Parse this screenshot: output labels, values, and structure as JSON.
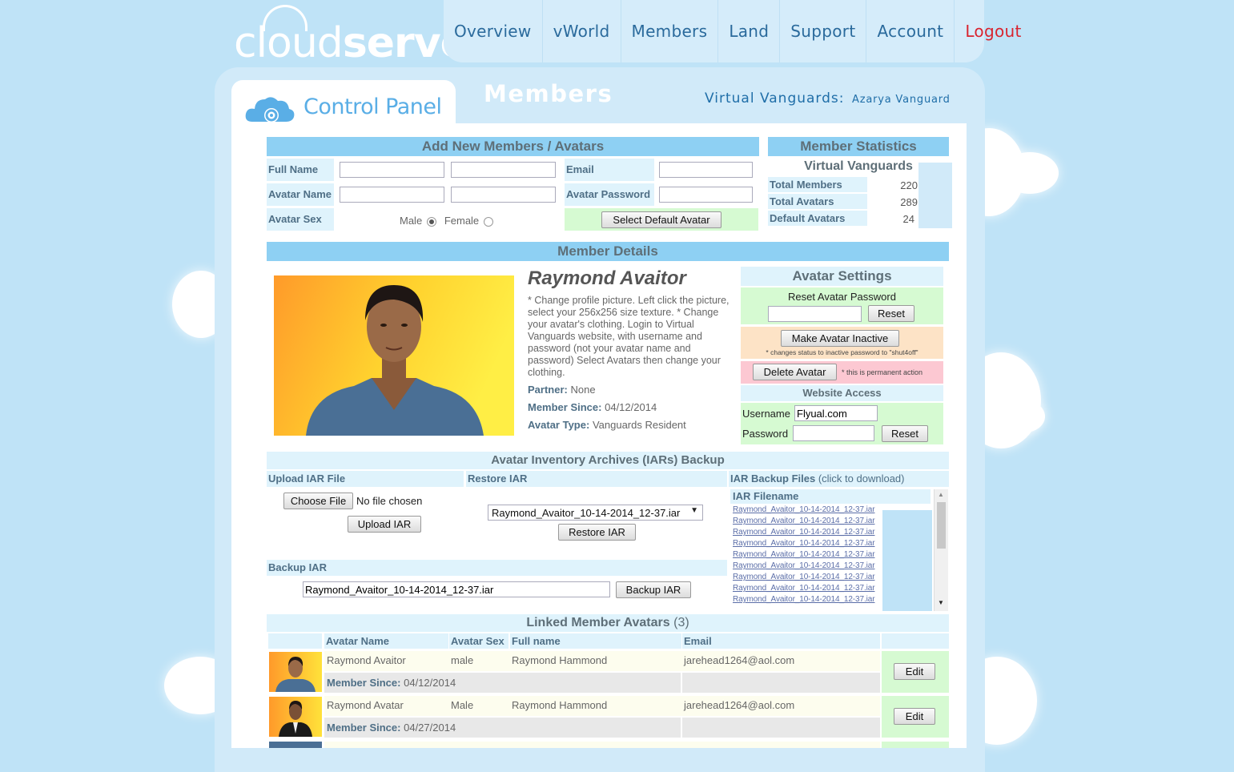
{
  "brand": {
    "logo_light": "cloud",
    "logo_bold": "serve"
  },
  "nav": [
    {
      "label": "Overview"
    },
    {
      "label": "vWorld"
    },
    {
      "label": "Members"
    },
    {
      "label": "Land"
    },
    {
      "label": "Support"
    },
    {
      "label": "Account"
    },
    {
      "label": "Logout"
    }
  ],
  "control_panel": {
    "label": "Control Panel"
  },
  "page": {
    "title": "Members",
    "group_label": "Virtual Vanguards:",
    "user_name": "Azarya Vanguard"
  },
  "add_members": {
    "title": "Add New Members / Avatars",
    "full_name_label": "Full Name",
    "avatar_name_label": "Avatar Name",
    "avatar_sex_label": "Avatar Sex",
    "email_label": "Email",
    "avatar_password_label": "Avatar Password",
    "male_label": "Male",
    "female_label": "Female",
    "select_default_avatar": "Select Default Avatar"
  },
  "stats": {
    "title": "Member Statistics",
    "group": "Virtual Vanguards",
    "rows": [
      {
        "label": "Total Members",
        "value": "220"
      },
      {
        "label": "Total Avatars",
        "value": "289"
      },
      {
        "label": "Default Avatars",
        "value": "24"
      }
    ]
  },
  "details": {
    "title": "Member Details",
    "avatar_name": "Raymond Avaitor",
    "description": "* Change profile picture. Left click the picture, select your 256x256 size texture. * Change your avatar's clothing. Login to Virtual Vanguards website, with username and password (not your avatar name and password) Select Avatars then change your clothing.",
    "partner_label": "Partner:",
    "partner": "None",
    "since_label": "Member Since:",
    "since": "04/12/2014",
    "type_label": "Avatar Type:",
    "type": "Vanguards Resident"
  },
  "avatar_settings": {
    "title": "Avatar Settings",
    "reset_password_label": "Reset Avatar Password",
    "reset": "Reset",
    "make_inactive": "Make Avatar Inactive",
    "inactive_note": "* changes status to inactive password to \"shut4off\"",
    "delete": "Delete Avatar",
    "delete_note": "* this is permanent action",
    "website_access": "Website Access",
    "username_label": "Username",
    "username_value": "Flyual.com",
    "password_label": "Password",
    "reset2": "Reset"
  },
  "iar": {
    "title": "Avatar Inventory Archives (IARs) Backup",
    "upload_label": "Upload IAR File",
    "restore_label": "Restore IAR",
    "backup_files_label": "IAR Backup Files",
    "backup_files_hint": "(click to download)",
    "choose_file": "Choose File",
    "no_file": "No file chosen",
    "upload_button": "Upload IAR",
    "restore_select": "Raymond_Avaitor_10-14-2014_12-37.iar",
    "restore_button": "Restore IAR",
    "backup_label": "Backup IAR",
    "backup_value": "Raymond_Avaitor_10-14-2014_12-37.iar",
    "backup_button": "Backup IAR",
    "filename_header": "IAR Filename",
    "files": [
      "Raymond_Avaitor_10-14-2014_12-37.iar",
      "Raymond_Avaitor_10-14-2014_12-37.iar",
      "Raymond_Avaitor_10-14-2014_12-37.iar",
      "Raymond_Avaitor_10-14-2014_12-37.iar",
      "Raymond_Avaitor_10-14-2014_12-37.iar",
      "Raymond_Avaitor_10-14-2014_12-37.iar",
      "Raymond_Avaitor_10-14-2014_12-37.iar",
      "Raymond_Avaitor_10-14-2014_12-37.iar",
      "Raymond_Avaitor_10-14-2014_12-37.iar"
    ]
  },
  "linked": {
    "title": "Linked Member Avatars",
    "count": "(3)",
    "columns": [
      "Avatar Name",
      "Avatar Sex",
      "Full name",
      "Email"
    ],
    "since_label": "Member Since:",
    "edit": "Edit",
    "rows": [
      {
        "name": "Raymond Avaitor",
        "sex": "male",
        "full_name": "Raymond Hammond",
        "email": "jarehead1264@aol.com",
        "since": "04/12/2014"
      },
      {
        "name": "Raymond Avatar",
        "sex": "Male",
        "full_name": "Raymond Hammond",
        "email": "jarehead1264@aol.com",
        "since": "04/27/2014"
      }
    ]
  }
}
